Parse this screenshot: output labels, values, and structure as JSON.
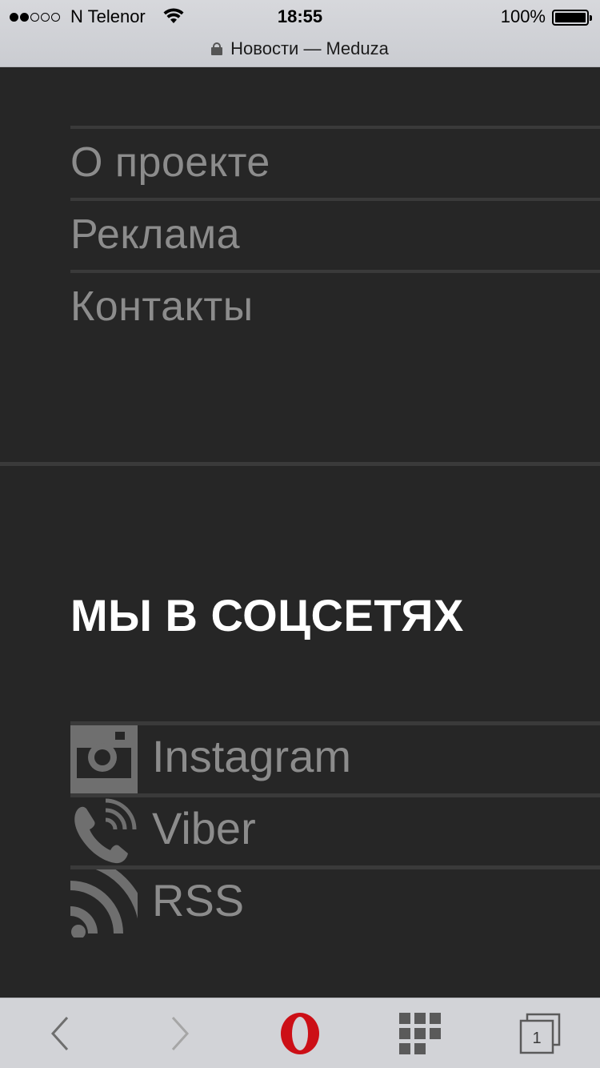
{
  "status_bar": {
    "carrier": "N Telenor",
    "time": "18:55",
    "battery": "100%",
    "signal_bars_filled": 2,
    "signal_bars_total": 5
  },
  "address_bar": {
    "title": "Новости — Meduza"
  },
  "nav_menu": {
    "items": [
      {
        "label": "О проекте"
      },
      {
        "label": "Реклама"
      },
      {
        "label": "Контакты"
      }
    ]
  },
  "social": {
    "heading": "МЫ В СОЦСЕТЯХ",
    "items": [
      {
        "label": "Instagram",
        "icon": "instagram-icon"
      },
      {
        "label": "Viber",
        "icon": "viber-icon"
      },
      {
        "label": "RSS",
        "icon": "rss-icon"
      }
    ]
  },
  "toolbar": {
    "tabs_count": "1",
    "icons": [
      "back-arrow-icon",
      "forward-arrow-icon",
      "opera-logo-icon",
      "speed-dial-grid-icon",
      "tabs-icon"
    ]
  },
  "colors": {
    "background": "#262626",
    "menu_text": "#8c8c8c",
    "heading_text": "#ffffff",
    "opera_red": "#cc0f16"
  }
}
